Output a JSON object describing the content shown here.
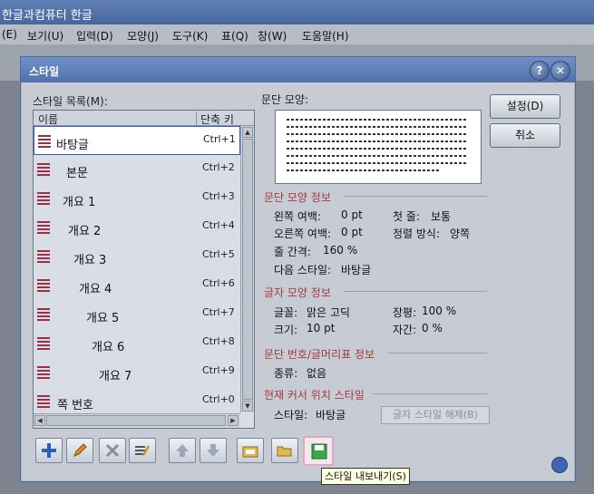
{
  "app": {
    "title": "한글과컴퓨터 한글",
    "menu": [
      "(E)",
      "보기(U)",
      "입력(D)",
      "모양(J)",
      "도구(K)",
      "표(Q)",
      "창(W)",
      "도움말(H)"
    ]
  },
  "dialog": {
    "title": "스타일",
    "help_label": "?",
    "close_label": "✕",
    "list_label": "스타일 목록(M):",
    "col_name": "이름",
    "col_key": "단축 키",
    "styles": [
      {
        "name": "바탕글",
        "key": "Ctrl+1"
      },
      {
        "name": "본문",
        "key": "Ctrl+2"
      },
      {
        "name": "개요 1",
        "key": "Ctrl+3"
      },
      {
        "name": "개요 2",
        "key": "Ctrl+4"
      },
      {
        "name": "개요 3",
        "key": "Ctrl+5"
      },
      {
        "name": "개요 4",
        "key": "Ctrl+6"
      },
      {
        "name": "개요 5",
        "key": "Ctrl+7"
      },
      {
        "name": "개요 6",
        "key": "Ctrl+8"
      },
      {
        "name": "개요 7",
        "key": "Ctrl+9"
      },
      {
        "name": "쪽 번호",
        "key": "Ctrl+0"
      }
    ],
    "preview_label": "문단 모양:",
    "set_button": "설정(D)",
    "cancel_button": "취소",
    "para_section": "문단 모양 정보",
    "para_info": {
      "left_margin": "왼쪽 여백:",
      "left_margin_val": "0 pt",
      "right_margin": "오른쪽 여백:",
      "right_margin_val": "0 pt",
      "line_spacing": "줄 간격:",
      "line_spacing_val": "160 %",
      "next_style": "다음 스타일:",
      "next_style_val": "바탕글",
      "first_line": "첫 줄:",
      "first_line_val": "보통",
      "align": "정렬 방식:",
      "align_val": "양쪽"
    },
    "char_section": "글자 모양 정보",
    "char_info": {
      "font": "글꼴:",
      "font_val": "맑은 고딕",
      "size": "크기:",
      "size_val": "10 pt",
      "width": "장평:",
      "width_val": "100 %",
      "spacing": "자간:",
      "spacing_val": "0 %"
    },
    "num_section": "문단 번호/글머리표 정보",
    "num_info": {
      "kind": "종류:",
      "kind_val": "없음"
    },
    "cur_section": "현재 커서 위치 스타일",
    "cur_info": {
      "style": "스타일:",
      "style_val": "바탕글",
      "release_button": "글자 스타일 해제(B)"
    },
    "tooltip": "스타일 내보내기(S)"
  },
  "colors": {
    "section": "#a33a3a",
    "title_bar": "#4f70aa",
    "selected_border": "#3a5fa8"
  }
}
